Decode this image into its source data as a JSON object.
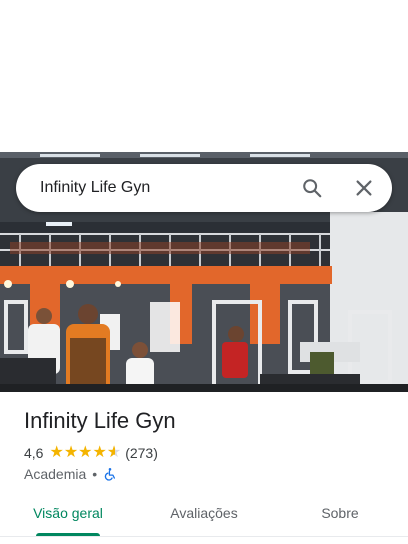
{
  "search": {
    "query": "Infinity Life Gyn"
  },
  "place": {
    "name": "Infinity Life Gyn",
    "rating": "4,6",
    "rating_value": 4.6,
    "review_count": "(273)",
    "category": "Academia",
    "separator": "•",
    "accessibility_icon": "wheelchair-icon"
  },
  "tabs": [
    {
      "label": "Visão geral",
      "active": true
    },
    {
      "label": "Avaliações",
      "active": false
    },
    {
      "label": "Sobre",
      "active": false
    }
  ],
  "colors": {
    "accent": "#01875f",
    "star": "#f4b400",
    "accessibility_icon": "#1a73e8"
  }
}
